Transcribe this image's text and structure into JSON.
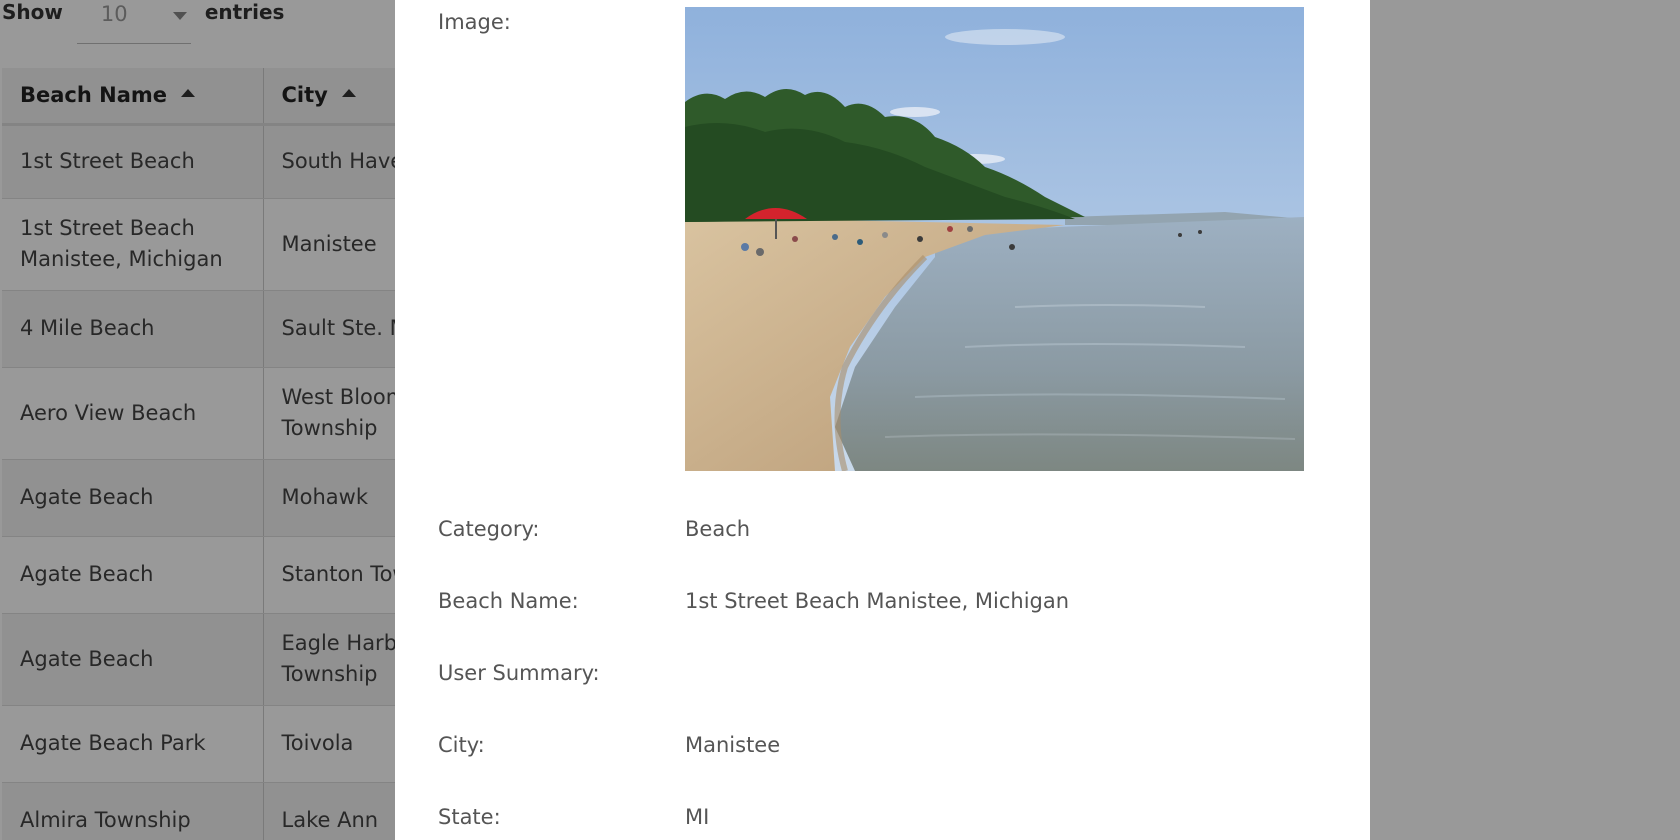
{
  "table_controls": {
    "show_label": "Show",
    "length_value": "10",
    "entries_label": "entries"
  },
  "table": {
    "headers": [
      "Beach Name",
      "City"
    ],
    "rows": [
      {
        "name": "1st Street Beach",
        "city": "South Haven"
      },
      {
        "name": "1st Street Beach Manistee, Michigan",
        "city": "Manistee"
      },
      {
        "name": "4 Mile Beach",
        "city": "Sault Ste. Marie"
      },
      {
        "name": "Aero View Beach",
        "city": "West Bloomfield Township"
      },
      {
        "name": "Agate Beach",
        "city": "Mohawk"
      },
      {
        "name": "Agate Beach",
        "city": "Stanton Township"
      },
      {
        "name": "Agate Beach",
        "city": "Eagle Harbor Township"
      },
      {
        "name": "Agate Beach Park",
        "city": "Toivola"
      },
      {
        "name": "Almira Township",
        "city": "Lake Ann"
      }
    ]
  },
  "modal": {
    "image_label": "Image:",
    "category_label": "Category:",
    "category_value": "Beach",
    "beach_name_label": "Beach Name:",
    "beach_name_value": "1st Street Beach Manistee, Michigan",
    "user_summary_label": "User Summary:",
    "user_summary_value": "",
    "city_label": "City:",
    "city_value": "Manistee",
    "state_label": "State:",
    "state_value": "MI"
  },
  "colors": {
    "overlay": "rgba(0,0,0,0.4)",
    "modal_bg": "#ffffff",
    "text": "#555555"
  }
}
